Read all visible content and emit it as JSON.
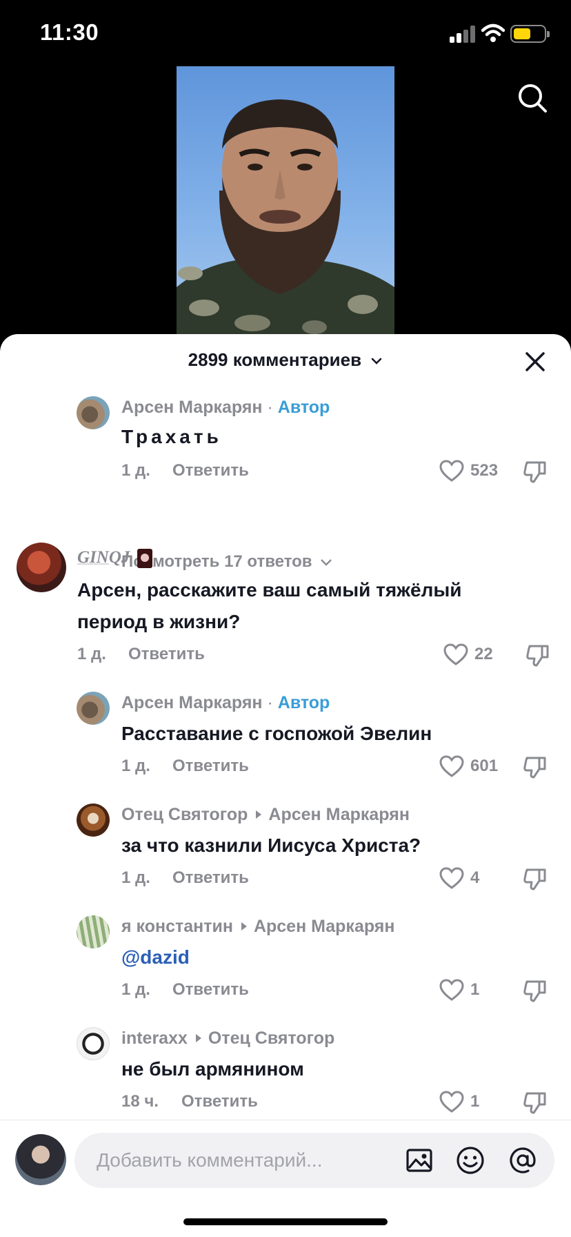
{
  "status_bar": {
    "time": "11:30",
    "battery_color": "#ffd60a"
  },
  "comments_header": {
    "count_label": "2899 комментариев"
  },
  "comments": [
    {
      "user": "Арсен Маркарян",
      "sep": "·",
      "badge": "Автор",
      "text": "Трахать",
      "time": "1 д.",
      "reply": "Ответить",
      "likes": "523"
    },
    {
      "user": "GINQJ",
      "text": "Арсен, расскажите ваш самый тяжёлый период в жизни?",
      "time": "1 д.",
      "reply": "Ответить",
      "likes": "22"
    },
    {
      "user": "Арсен Маркарян",
      "sep": "·",
      "badge": "Автор",
      "text": "Расставание с госпожой Эвелин",
      "time": "1 д.",
      "reply": "Ответить",
      "likes": "601"
    },
    {
      "user": "Отец Святогор",
      "reply_to": "Арсен Маркарян",
      "text": "за что казнили Иисуса Христа?",
      "time": "1 д.",
      "reply": "Ответить",
      "likes": "4"
    },
    {
      "user": "я константин",
      "reply_to": "Арсен Маркарян",
      "text": "@dazid",
      "time": "1 д.",
      "reply": "Ответить",
      "likes": "1"
    },
    {
      "user": "interaxx",
      "reply_to": "Отец Святогор",
      "text": "не был армянином",
      "time": "18 ч.",
      "reply": "Ответить",
      "likes": "1"
    }
  ],
  "view_replies": "Посмотреть 17 ответов",
  "input": {
    "placeholder": "Добавить комментарий..."
  },
  "icons": [
    "search-icon",
    "chevron-down-icon",
    "close-icon",
    "heart-icon",
    "dislike-icon",
    "image-icon",
    "emoji-icon",
    "at-icon"
  ],
  "colors": {
    "author_badge": "#3a9dd6",
    "mention": "#2b5fb6",
    "meta": "#8a8b91"
  }
}
